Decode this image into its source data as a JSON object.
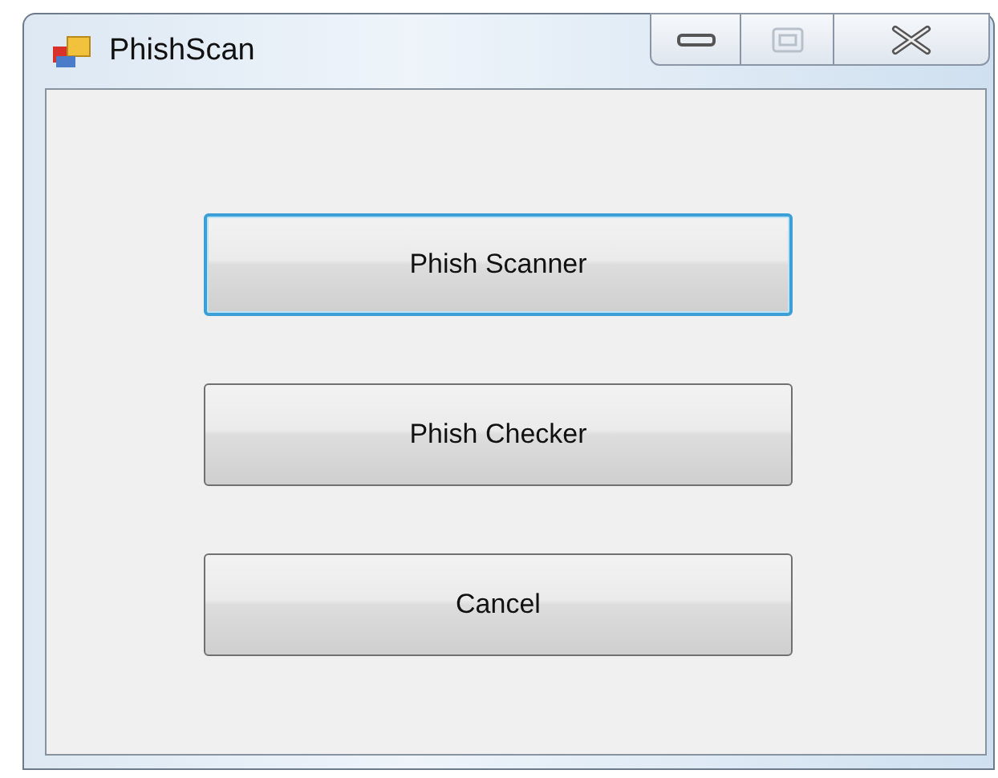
{
  "window": {
    "title": "PhishScan",
    "maximize_disabled": true
  },
  "buttons": [
    {
      "label": "Phish Scanner",
      "focused": true
    },
    {
      "label": "Phish Checker",
      "focused": false
    },
    {
      "label": "Cancel",
      "focused": false
    }
  ]
}
